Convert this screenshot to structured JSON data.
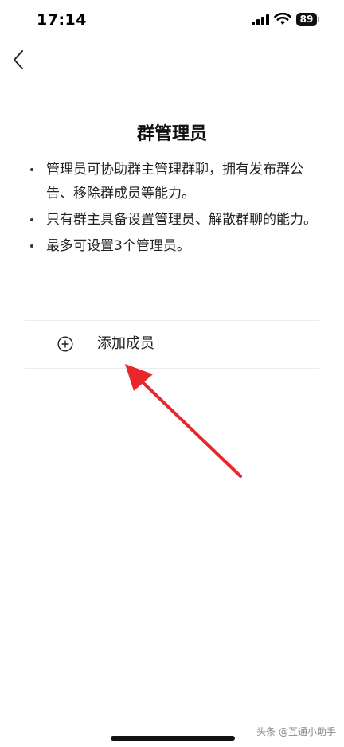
{
  "status_bar": {
    "time": "17:14",
    "battery_level": "89"
  },
  "nav": {
    "back_icon": "chevron-left-icon"
  },
  "page": {
    "title": "群管理员",
    "bullets": [
      "管理员可协助群主管理群聊，拥有发布群公告、移除群成员等能力。",
      "只有群主具备设置管理员、解散群聊的能力。",
      "最多可设置3个管理员。"
    ],
    "add_member": {
      "icon": "plus-circle-icon",
      "label": "添加成员"
    }
  },
  "annotation": {
    "arrow_color": "#e8262b"
  },
  "watermark": "头条 @互通小助手"
}
